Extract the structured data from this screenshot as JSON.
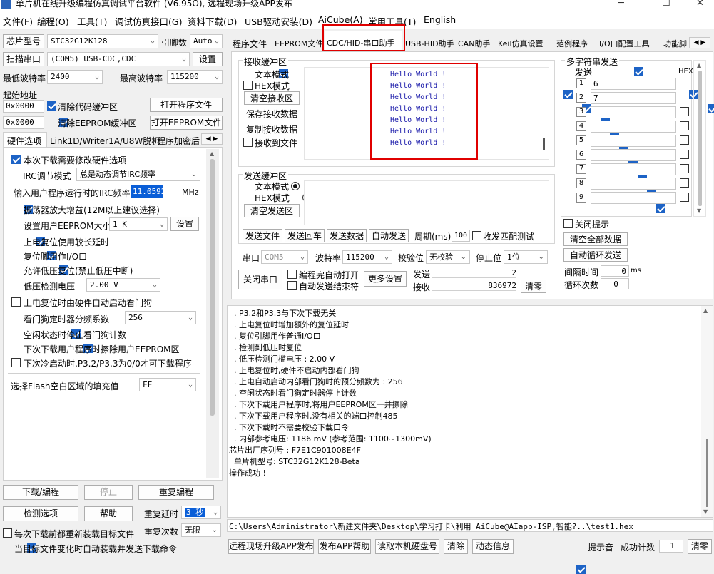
{
  "window": {
    "title": "单片机在线升级编程仿真调试平台软件 (V6.95O), 远程现场升级APP发布"
  },
  "menu": [
    "文件(F)",
    "编程(O)",
    "工具(T)",
    "调试仿真接口(G)",
    "资料下载(D)",
    "USB驱动安装(D)",
    "AiCube(A)",
    "常用工具(T)",
    "English"
  ],
  "left": {
    "chip_label": "芯片型号",
    "chip_value": "STC32G12K128",
    "pin_label": "引脚数",
    "pin_value": "Auto",
    "scan_btn": "扫描串口",
    "port_value": "(COM5) USB-CDC,CDC",
    "settings_btn": "设置",
    "min_baud_label": "最低波特率",
    "min_baud": "2400",
    "max_baud_label": "最高波特率",
    "max_baud": "115200",
    "start_addr_label": "起始地址",
    "addr1": "0x0000",
    "clear_code": "清除代码缓冲区",
    "open_prog": "打开程序文件",
    "addr2": "0x0000",
    "clear_eeprom": "清除EEPROM缓冲区",
    "open_eeprom": "打开EEPROM文件",
    "tabs": [
      "硬件选项",
      "Link1D/Writer1A/U8W脱机",
      "程序加密后"
    ],
    "opt_modify_hw": "本次下载需要修改硬件选项",
    "irc_label": "IRC调节模式",
    "irc_value": "总是动态调节IRC频率",
    "freq_label": "输入用户程序运行时的IRC频率",
    "freq_value": "11.0592",
    "freq_unit": "MHz",
    "opt_gain": "振荡器放大增益(12M以上建议选择)",
    "eeprom_size_label": "设置用户EEPROM大小",
    "eeprom_size": "1   K",
    "eeprom_set_btn": "设置",
    "opt_long_delay": "上电复位使用较长延时",
    "opt_reset_io": "复位脚用作I/O口",
    "opt_lvd": "允许低压复位(禁止低压中断)",
    "lvd_label": "低压检测电压",
    "lvd_value": "2.00 V",
    "opt_wdt": "上电复位时由硬件自动启动看门狗",
    "wdt_label": "看门狗定时器分频系数",
    "wdt_value": "256",
    "opt_idle_wdt": "空闲状态时停止看门狗计数",
    "opt_erase_eeprom": "下次下载用户程序时擦除用户EEPROM区",
    "opt_p32": "下次冷启动时,P3.2/P3.3为0/0才可下载程序",
    "fill_label": "选择Flash空白区域的填充值",
    "fill_value": "FF",
    "download_btn": "下载/编程",
    "stop_btn": "停止",
    "reprog_btn": "重复编程",
    "check_btn": "检测选项",
    "help_btn": "帮助",
    "repeat_delay_label": "重复延时",
    "repeat_delay": "3 秒",
    "reload_label": "每次下载前都重新装载目标文件",
    "repeat_count_label": "重复次数",
    "repeat_count": "无限",
    "auto_send_label": "当目标文件变化时自动装载并发送下载命令"
  },
  "tabs": [
    "程序文件",
    "EEPROM文件",
    "CDC/HID-串口助手",
    "USB-HID助手",
    "CAN助手",
    "Keil仿真设置",
    "范例程序",
    "I/O口配置工具",
    "功能脚"
  ],
  "serial": {
    "rx_title": "接收缓冲区",
    "rx_text_mode": "文本模式",
    "rx_hex_mode": "HEX模式",
    "clear_rx": "清空接收区",
    "save_rx": "保存接收数据",
    "copy_rx": "复制接收数据",
    "rx_to_file": "接收到文件",
    "rx_lines": [
      "Hello World !",
      "Hello World !",
      "Hello World !",
      "Hello World !",
      "Hello World !",
      "Hello World !",
      "Hello World !"
    ],
    "tx_title": "发送缓冲区",
    "tx_text_mode": "文本模式",
    "tx_hex_mode": "HEX模式",
    "clear_tx": "清空发送区",
    "send_file": "发送文件",
    "send_enter": "发送回车",
    "send_data": "发送数据",
    "auto_send": "自动发送",
    "period_label": "周期(ms)",
    "period": "100",
    "match_test": "收发匹配测试",
    "port_label": "串口",
    "port": "COM5",
    "baud_label": "波特率",
    "baud": "115200",
    "parity_label": "校验位",
    "parity": "无校验",
    "stop_label": "停止位",
    "stop": "1位",
    "close_port": "关闭串口",
    "auto_open": "编程完自动打开",
    "auto_send_end": "自动发送结束符",
    "more_settings": "更多设置",
    "sent_label": "发送",
    "sent": "2",
    "recv_label": "接收",
    "recv": "836972",
    "clear_count": "清零"
  },
  "multi": {
    "title": "多字符串发送",
    "send_col": "发送",
    "hex_col": "HEX",
    "rows": [
      {
        "n": "1",
        "v": "6"
      },
      {
        "n": "2",
        "v": "7"
      },
      {
        "n": "3",
        "v": ""
      },
      {
        "n": "4",
        "v": ""
      },
      {
        "n": "5",
        "v": ""
      },
      {
        "n": "6",
        "v": ""
      },
      {
        "n": "7",
        "v": ""
      },
      {
        "n": "8",
        "v": ""
      },
      {
        "n": "9",
        "v": ""
      }
    ],
    "close_tip": "关闭提示",
    "clear_all": "清空全部数据",
    "auto_loop": "自动循环发送",
    "interval_label": "间隔时间",
    "interval": "0",
    "interval_unit": "ms",
    "loop_label": "循环次数",
    "loop": "0"
  },
  "log": [
    "  . P3.2和P3.3与下次下载无关",
    "  . 上电复位时增加额外的复位延时",
    "  . 复位引脚用作普通I/O口",
    "  . 检测到低压时复位",
    "  . 低压检测门槛电压 : 2.00 V",
    "  . 上电复位时,硬件不启动内部看门狗",
    "  . 上电自动启动内部看门狗时的预分频数为 : 256",
    "  . 空闲状态时看门狗定时器停止计数",
    "  . 下次下载用户程序时,将用户EEPROM区一并擦除",
    "  . 下次下载用户程序时,没有相关的端口控制485",
    "  . 下次下载时不需要校验下载口令",
    "  . 内部参考电压: 1186 mV (参考范围: 1100~1300mV)",
    "芯片出厂序列号 : F7E1C901008E4F",
    "",
    "  单片机型号: STC32G12K128-Beta",
    "",
    "操作成功 !"
  ],
  "path": "C:\\Users\\Administrator\\新建文件夹\\Desktop\\学习打卡\\利用 AiCube@AIapp-ISP,智能?..\\test1.hex",
  "bottom": {
    "publish": "远程现场升级APP发布",
    "publish_help": "发布APP帮助",
    "read_disk": "读取本机硬盘号",
    "clear": "清除",
    "anim": "动态信息",
    "sound": "提示音",
    "success_label": "成功计数",
    "success": "1",
    "reset": "清零"
  }
}
